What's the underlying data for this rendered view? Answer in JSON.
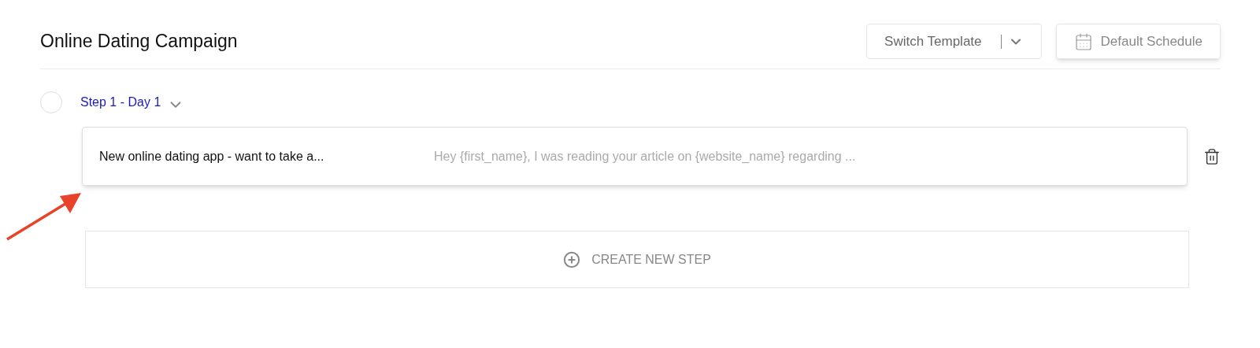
{
  "title": "Online Dating Campaign",
  "header_buttons": [
    {
      "kind": "dropdown",
      "label": "Switch Template"
    },
    {
      "kind": "schedule",
      "label": "Default Schedule"
    }
  ],
  "steps": [
    {
      "label": "Step 1 - Day 1",
      "checked": false,
      "emails": [
        {
          "subject": "New online dating app - want to take a...",
          "preview": "Hey {first_name}, I was reading your article on {website_name} regarding ..."
        }
      ]
    }
  ],
  "create_step": {
    "label": "CREATE NEW STEP"
  }
}
